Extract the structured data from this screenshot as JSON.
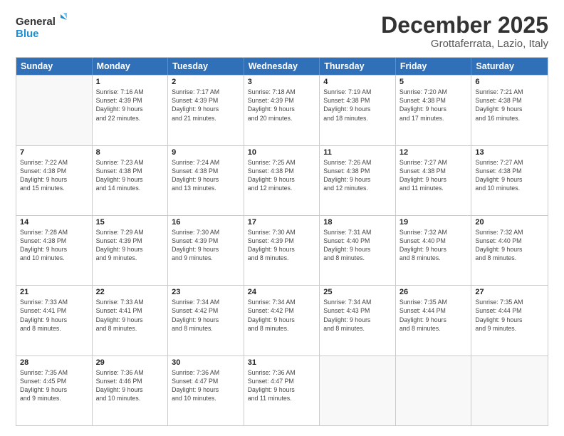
{
  "logo": {
    "line1": "General",
    "line2": "Blue"
  },
  "title": "December 2025",
  "location": "Grottaferrata, Lazio, Italy",
  "days_of_week": [
    "Sunday",
    "Monday",
    "Tuesday",
    "Wednesday",
    "Thursday",
    "Friday",
    "Saturday"
  ],
  "weeks": [
    [
      {
        "day": "",
        "info": ""
      },
      {
        "day": "1",
        "info": "Sunrise: 7:16 AM\nSunset: 4:39 PM\nDaylight: 9 hours\nand 22 minutes."
      },
      {
        "day": "2",
        "info": "Sunrise: 7:17 AM\nSunset: 4:39 PM\nDaylight: 9 hours\nand 21 minutes."
      },
      {
        "day": "3",
        "info": "Sunrise: 7:18 AM\nSunset: 4:39 PM\nDaylight: 9 hours\nand 20 minutes."
      },
      {
        "day": "4",
        "info": "Sunrise: 7:19 AM\nSunset: 4:38 PM\nDaylight: 9 hours\nand 18 minutes."
      },
      {
        "day": "5",
        "info": "Sunrise: 7:20 AM\nSunset: 4:38 PM\nDaylight: 9 hours\nand 17 minutes."
      },
      {
        "day": "6",
        "info": "Sunrise: 7:21 AM\nSunset: 4:38 PM\nDaylight: 9 hours\nand 16 minutes."
      }
    ],
    [
      {
        "day": "7",
        "info": "Sunrise: 7:22 AM\nSunset: 4:38 PM\nDaylight: 9 hours\nand 15 minutes."
      },
      {
        "day": "8",
        "info": "Sunrise: 7:23 AM\nSunset: 4:38 PM\nDaylight: 9 hours\nand 14 minutes."
      },
      {
        "day": "9",
        "info": "Sunrise: 7:24 AM\nSunset: 4:38 PM\nDaylight: 9 hours\nand 13 minutes."
      },
      {
        "day": "10",
        "info": "Sunrise: 7:25 AM\nSunset: 4:38 PM\nDaylight: 9 hours\nand 12 minutes."
      },
      {
        "day": "11",
        "info": "Sunrise: 7:26 AM\nSunset: 4:38 PM\nDaylight: 9 hours\nand 12 minutes."
      },
      {
        "day": "12",
        "info": "Sunrise: 7:27 AM\nSunset: 4:38 PM\nDaylight: 9 hours\nand 11 minutes."
      },
      {
        "day": "13",
        "info": "Sunrise: 7:27 AM\nSunset: 4:38 PM\nDaylight: 9 hours\nand 10 minutes."
      }
    ],
    [
      {
        "day": "14",
        "info": "Sunrise: 7:28 AM\nSunset: 4:38 PM\nDaylight: 9 hours\nand 10 minutes."
      },
      {
        "day": "15",
        "info": "Sunrise: 7:29 AM\nSunset: 4:39 PM\nDaylight: 9 hours\nand 9 minutes."
      },
      {
        "day": "16",
        "info": "Sunrise: 7:30 AM\nSunset: 4:39 PM\nDaylight: 9 hours\nand 9 minutes."
      },
      {
        "day": "17",
        "info": "Sunrise: 7:30 AM\nSunset: 4:39 PM\nDaylight: 9 hours\nand 8 minutes."
      },
      {
        "day": "18",
        "info": "Sunrise: 7:31 AM\nSunset: 4:40 PM\nDaylight: 9 hours\nand 8 minutes."
      },
      {
        "day": "19",
        "info": "Sunrise: 7:32 AM\nSunset: 4:40 PM\nDaylight: 9 hours\nand 8 minutes."
      },
      {
        "day": "20",
        "info": "Sunrise: 7:32 AM\nSunset: 4:40 PM\nDaylight: 9 hours\nand 8 minutes."
      }
    ],
    [
      {
        "day": "21",
        "info": "Sunrise: 7:33 AM\nSunset: 4:41 PM\nDaylight: 9 hours\nand 8 minutes."
      },
      {
        "day": "22",
        "info": "Sunrise: 7:33 AM\nSunset: 4:41 PM\nDaylight: 9 hours\nand 8 minutes."
      },
      {
        "day": "23",
        "info": "Sunrise: 7:34 AM\nSunset: 4:42 PM\nDaylight: 9 hours\nand 8 minutes."
      },
      {
        "day": "24",
        "info": "Sunrise: 7:34 AM\nSunset: 4:42 PM\nDaylight: 9 hours\nand 8 minutes."
      },
      {
        "day": "25",
        "info": "Sunrise: 7:34 AM\nSunset: 4:43 PM\nDaylight: 9 hours\nand 8 minutes."
      },
      {
        "day": "26",
        "info": "Sunrise: 7:35 AM\nSunset: 4:44 PM\nDaylight: 9 hours\nand 8 minutes."
      },
      {
        "day": "27",
        "info": "Sunrise: 7:35 AM\nSunset: 4:44 PM\nDaylight: 9 hours\nand 9 minutes."
      }
    ],
    [
      {
        "day": "28",
        "info": "Sunrise: 7:35 AM\nSunset: 4:45 PM\nDaylight: 9 hours\nand 9 minutes."
      },
      {
        "day": "29",
        "info": "Sunrise: 7:36 AM\nSunset: 4:46 PM\nDaylight: 9 hours\nand 10 minutes."
      },
      {
        "day": "30",
        "info": "Sunrise: 7:36 AM\nSunset: 4:47 PM\nDaylight: 9 hours\nand 10 minutes."
      },
      {
        "day": "31",
        "info": "Sunrise: 7:36 AM\nSunset: 4:47 PM\nDaylight: 9 hours\nand 11 minutes."
      },
      {
        "day": "",
        "info": ""
      },
      {
        "day": "",
        "info": ""
      },
      {
        "day": "",
        "info": ""
      }
    ]
  ]
}
